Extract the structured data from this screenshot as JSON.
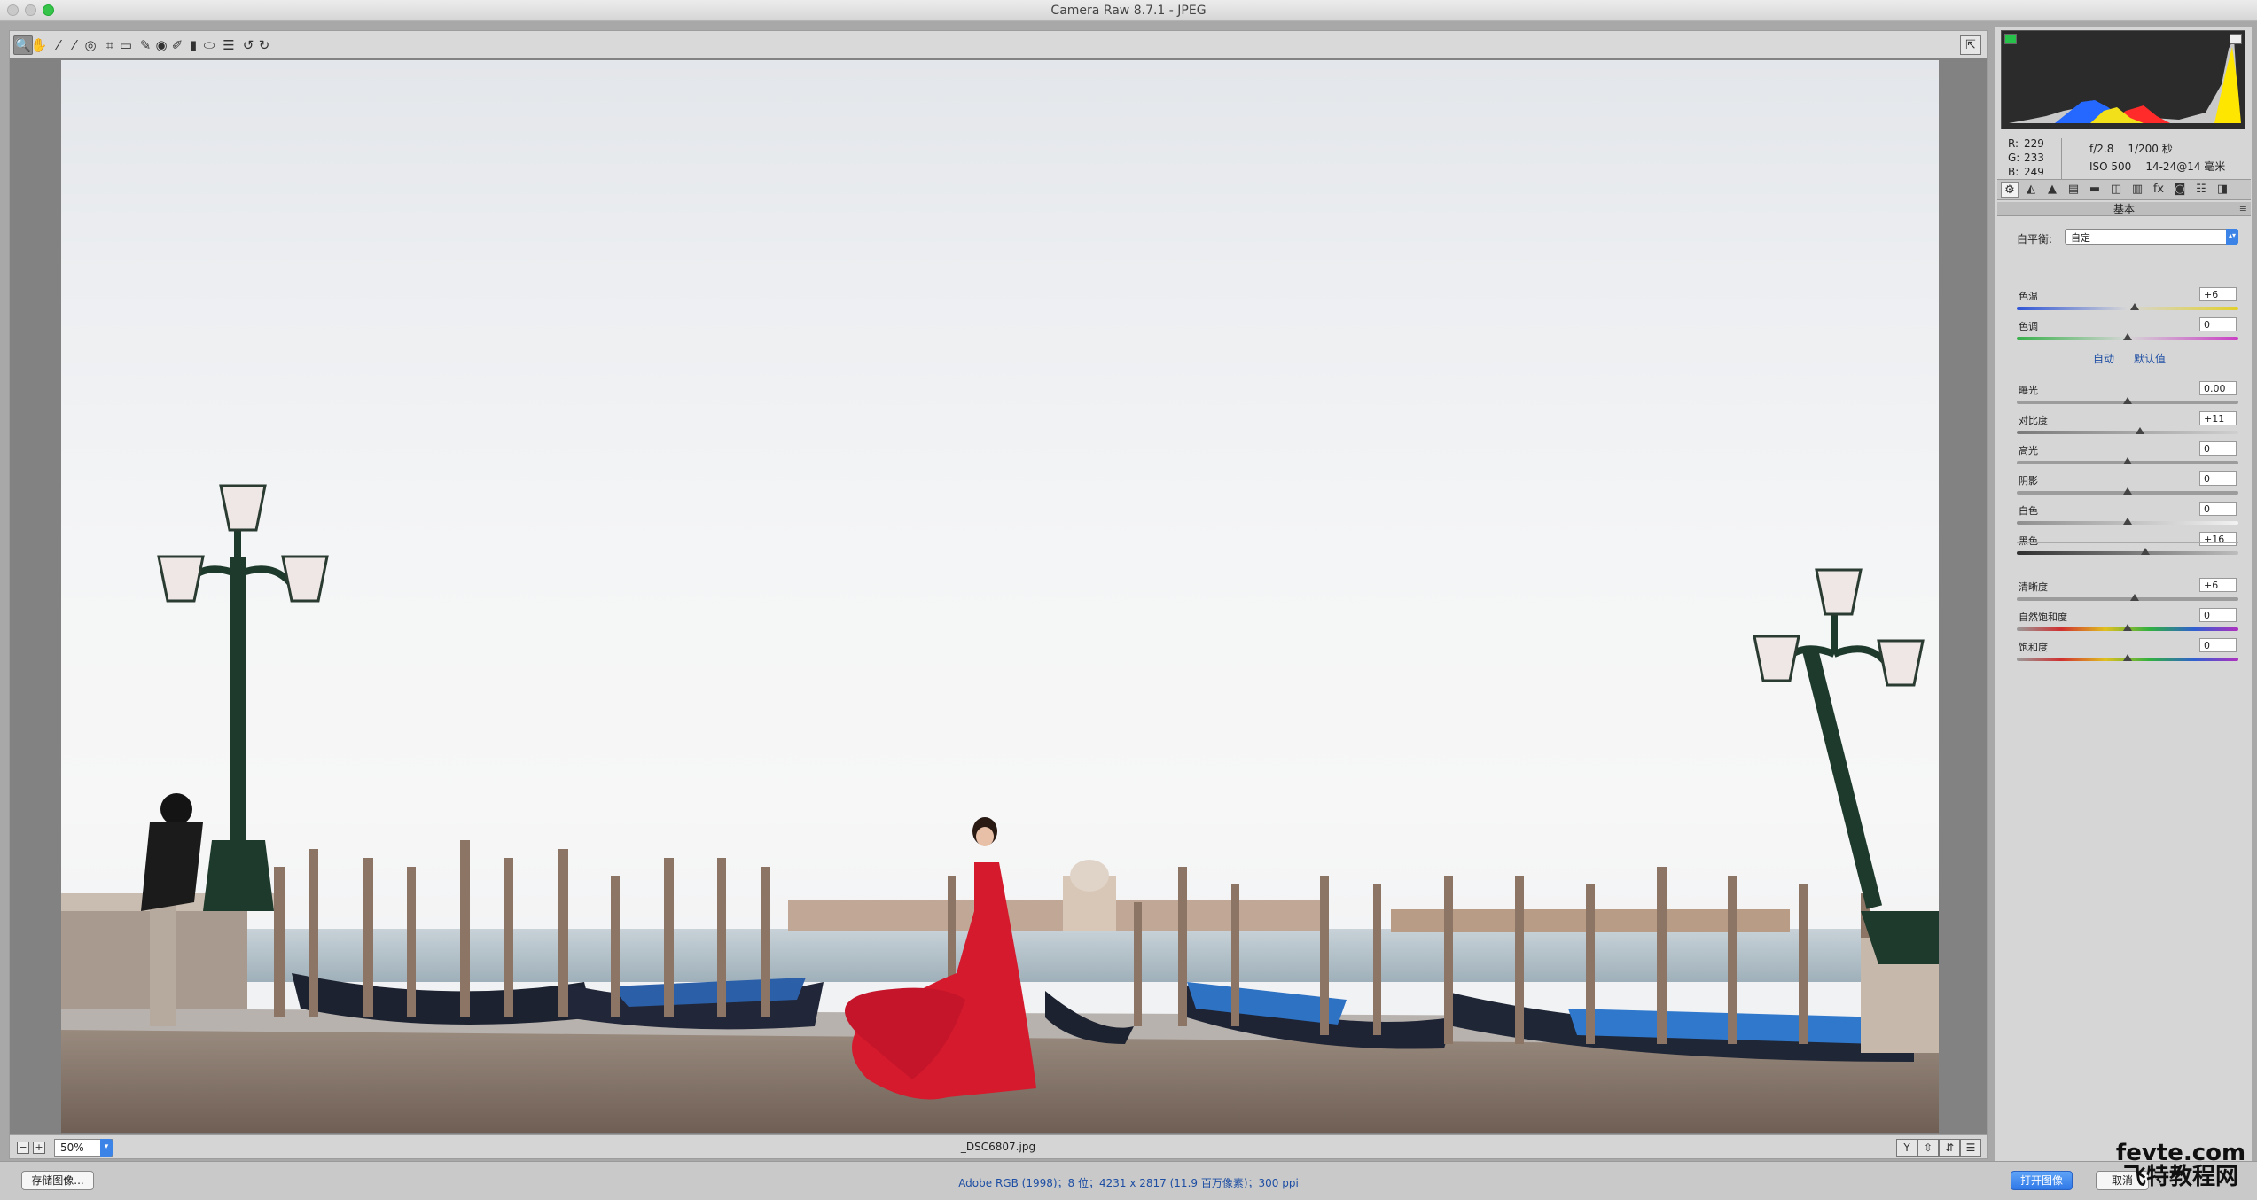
{
  "window": {
    "title": "Camera Raw 8.7.1 -  JPEG"
  },
  "toolbar": {
    "tools": [
      {
        "name": "zoom-tool",
        "icon": "magnifier-icon",
        "glyph": "🔍",
        "active": true
      },
      {
        "name": "hand-tool",
        "icon": "hand-icon",
        "glyph": "✋"
      },
      {
        "name": "white-balance-tool",
        "icon": "eyedropper-icon",
        "glyph": "⁄"
      },
      {
        "name": "color-sampler-tool",
        "icon": "color-sampler-icon",
        "glyph": "⁄"
      },
      {
        "name": "targeted-adjustment-tool",
        "icon": "target-adjust-icon",
        "glyph": "◎"
      },
      {
        "name": "crop-tool",
        "icon": "crop-icon",
        "glyph": "⌗"
      },
      {
        "name": "straighten-tool",
        "icon": "straighten-icon",
        "glyph": "▭"
      },
      {
        "name": "spot-removal-tool",
        "icon": "spot-removal-icon",
        "glyph": "✎"
      },
      {
        "name": "red-eye-tool",
        "icon": "red-eye-icon",
        "glyph": "◉"
      },
      {
        "name": "adjustment-brush-tool",
        "icon": "brush-icon",
        "glyph": "✐"
      },
      {
        "name": "graduated-filter-tool",
        "icon": "graduated-filter-icon",
        "glyph": "▮"
      },
      {
        "name": "radial-filter-tool",
        "icon": "radial-filter-icon",
        "glyph": "⬭"
      },
      {
        "name": "preferences-tool",
        "icon": "list-icon",
        "glyph": "☰"
      },
      {
        "name": "rotate-ccw-tool",
        "icon": "rotate-left-icon",
        "glyph": "↺"
      },
      {
        "name": "rotate-cw-tool",
        "icon": "rotate-right-icon",
        "glyph": "↻"
      }
    ],
    "fullscreen_glyph": "⇱"
  },
  "preview": {
    "zoom_value": "50%",
    "filename": "_DSC6807.jpg",
    "zoom_out_glyph": "−",
    "zoom_in_glyph": "+",
    "view_buttons": [
      "Y",
      "⇳",
      "⇵",
      "☰"
    ]
  },
  "histogram": {
    "clip_left_color": "#27c24a",
    "clip_right_color": "#eeeeee"
  },
  "info": {
    "r_label": "R:",
    "r": "229",
    "g_label": "G:",
    "g": "233",
    "b_label": "B:",
    "b": "249",
    "aperture": "f/2.8",
    "shutter": "1/200 秒",
    "iso": "ISO 500",
    "lens": "14-24@14 毫米"
  },
  "panel": {
    "header": "基本",
    "menu_glyph": "≡",
    "tab_glyphs": [
      "⚙",
      "◭",
      "▲",
      "▤",
      "▬",
      "◫",
      "▥",
      "fx",
      "◙",
      "☷",
      "◨"
    ],
    "white_balance_label": "白平衡:",
    "white_balance_value": "自定",
    "auto_label": "自动",
    "default_label": "默认值",
    "sliders": [
      {
        "name": "temperature",
        "label": "色温",
        "value": "+6",
        "pos": 0.53
      },
      {
        "name": "tint",
        "label": "色调",
        "value": "0",
        "pos": 0.5
      },
      {
        "name": "exposure",
        "label": "曝光",
        "value": "0.00",
        "pos": 0.5
      },
      {
        "name": "contrast",
        "label": "对比度",
        "value": "+11",
        "pos": 0.555
      },
      {
        "name": "highlights",
        "label": "高光",
        "value": "0",
        "pos": 0.5
      },
      {
        "name": "shadows",
        "label": "阴影",
        "value": "0",
        "pos": 0.5
      },
      {
        "name": "whites",
        "label": "白色",
        "value": "0",
        "pos": 0.5
      },
      {
        "name": "blacks",
        "label": "黑色",
        "value": "+16",
        "pos": 0.58
      },
      {
        "name": "clarity",
        "label": "清晰度",
        "value": "+6",
        "pos": 0.53
      },
      {
        "name": "vibrance",
        "label": "自然饱和度",
        "value": "0",
        "pos": 0.5
      },
      {
        "name": "saturation",
        "label": "饱和度",
        "value": "0",
        "pos": 0.5
      }
    ]
  },
  "bottom": {
    "save_label": "存储图像...",
    "workflow_link": "Adobe RGB (1998)；8 位；4231 x 2817 (11.9 百万像素)；300 ppi",
    "open_label": "打开图像",
    "cancel_label": "取消"
  },
  "watermark": {
    "top": "fevte.com",
    "bottom": "飞特教程网"
  }
}
